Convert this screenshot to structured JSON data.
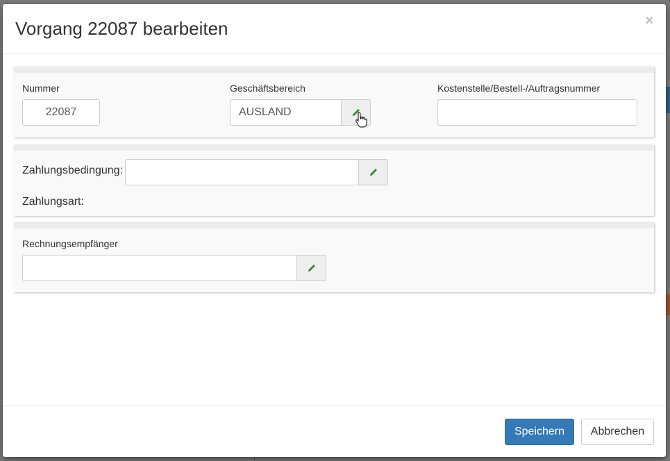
{
  "dialog": {
    "title": "Vorgang 22087 bearbeiten",
    "close": "×"
  },
  "section1": {
    "nummer_label": "Nummer",
    "nummer_value": "22087",
    "geschaeftsbereich_label": "Geschäftsbereich",
    "geschaeftsbereich_value": "AUSLAND",
    "kostenstelle_label": "Kostenstelle/Bestell-/Auftragsnummer",
    "kostenstelle_value": ""
  },
  "section2": {
    "zahlungsbedingung_label": "Zahlungsbedingung:",
    "zahlungsbedingung_value": "",
    "zahlungsart_label": "Zahlungsart:"
  },
  "section3": {
    "rechnungsempfaenger_label": "Rechnungsempfänger",
    "rechnungsempfaenger_value": ""
  },
  "footer": {
    "save_label": "Speichern",
    "cancel_label": "Abbrechen"
  },
  "colors": {
    "primary": "#337ab7",
    "pencil": "#2e8b2e"
  },
  "icons": [
    "pencil-icon",
    "hand-cursor-icon",
    "close-icon"
  ]
}
